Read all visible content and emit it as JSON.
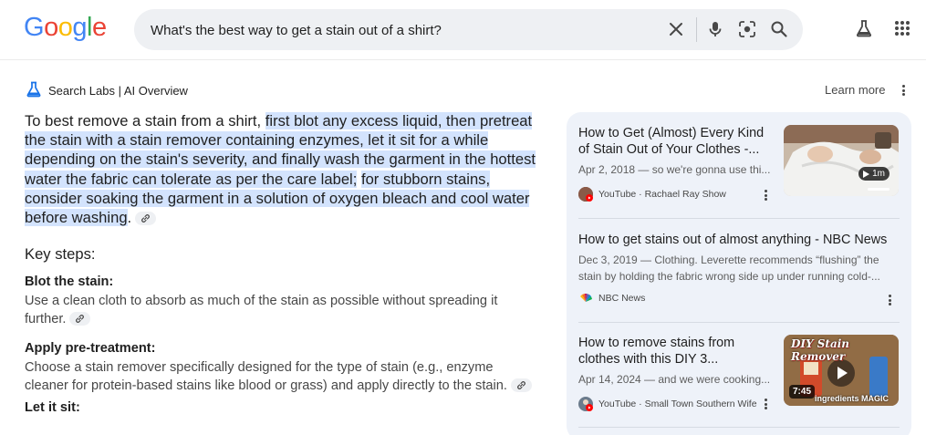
{
  "logo": {
    "letters": [
      "G",
      "o",
      "o",
      "g",
      "l",
      "e"
    ],
    "colors": [
      "#4285f4",
      "#ea4335",
      "#fbbc05",
      "#4285f4",
      "#34a853",
      "#ea4335"
    ]
  },
  "search": {
    "query": "What's the best way to get a stain out of a shirt?"
  },
  "icons": {
    "clear": "close-icon",
    "voice": "microphone-icon",
    "lens": "camera-lens-icon",
    "search": "search-icon",
    "labs": "flask-icon",
    "apps": "apps-grid-icon"
  },
  "ai_overview": {
    "label": "Search Labs | AI Overview",
    "learn_more": "Learn more",
    "summary_plain": "To best remove a stain from a shirt, ",
    "summary_hl1": "first blot any excess liquid, then pretreat the stain with a stain remover containing enzymes, let it sit for a while depending on the stain's severity, and finally wash the garment in the hottest water the fabric can tolerate as per the care label;",
    "summary_hl2": "for stubborn stains, consider soaking the garment in a solution of oxygen bleach and cool water before washing",
    "summary_end": ".",
    "key_steps_heading": "Key steps:",
    "steps": [
      {
        "title": "Blot the stain:",
        "body": "Use a clean cloth to absorb as much of the stain as possible without spreading it further."
      },
      {
        "title": "Apply pre-treatment:",
        "body": "Choose a stain remover specifically designed for the type of stain (e.g., enzyme cleaner for protein-based stains like blood or grass) and apply directly to the stain."
      },
      {
        "title": "Let it sit:",
        "body": ""
      }
    ]
  },
  "sources": [
    {
      "title": "How to Get (Almost) Every Kind of Stain Out of Your Clothes -...",
      "meta": "Apr 2, 2018 — so we're gonna use thi...",
      "source": "YouTube · Rachael Ray Show",
      "duration": "1m"
    },
    {
      "title": "How to get stains out of almost anything - NBC News",
      "meta": "Dec 3, 2019 — Clothing. Leverette recommends “flushing” the stain by holding the fabric wrong side up under running cold-...",
      "source": "NBC News"
    },
    {
      "title": "How to remove stains from clothes with this DIY 3...",
      "meta": "Apr 14, 2024 — and we were cooking...",
      "source": "YouTube · Small Town Southern Wife",
      "duration": "7:45",
      "thumb_caption": "DIY Stain Remover",
      "thumb_sub": "ingredients MAGIC"
    }
  ]
}
